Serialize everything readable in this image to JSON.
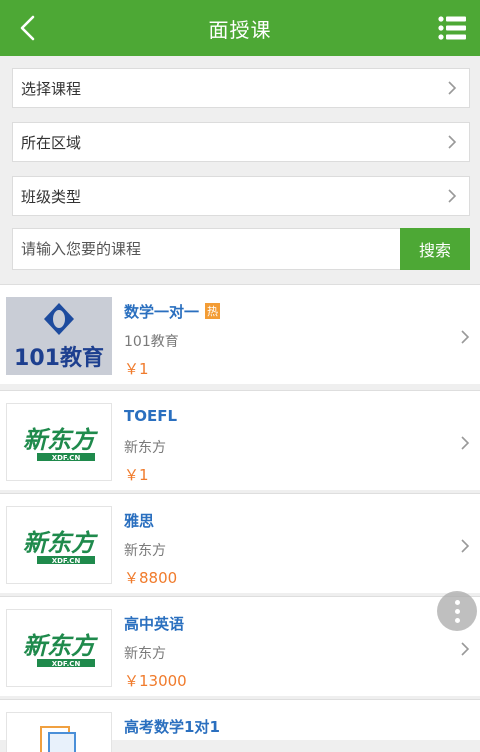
{
  "header": {
    "title": "面授课",
    "back_icon": "back-arrow-icon",
    "menu_icon": "list-menu-icon",
    "color": "#4da835"
  },
  "filters": [
    {
      "label": "选择课程"
    },
    {
      "label": "所在区域"
    },
    {
      "label": "班级类型"
    }
  ],
  "search": {
    "placeholder": "请输入您要的课程",
    "button_label": "搜索"
  },
  "courses": [
    {
      "name": "数学一对一",
      "badge": "热",
      "org": "101教育",
      "price": "￥1",
      "logo_text": "101教育"
    },
    {
      "name": "TOEFL",
      "org": "新东方",
      "price": "￥1",
      "logo_text": "新东方",
      "logo_sub": "XDF.CN"
    },
    {
      "name": "雅思",
      "org": "新东方",
      "price": "￥8800",
      "logo_text": "新东方",
      "logo_sub": "XDF.CN"
    },
    {
      "name": "高中英语",
      "org": "新东方",
      "price": "￥13000",
      "logo_text": "新东方",
      "logo_sub": "XDF.CN"
    },
    {
      "name": "高考数学1对1"
    }
  ],
  "colors": {
    "accent": "#4da835",
    "link": "#2a6fbf",
    "price": "#f07b2c",
    "badge": "#f39c34"
  }
}
